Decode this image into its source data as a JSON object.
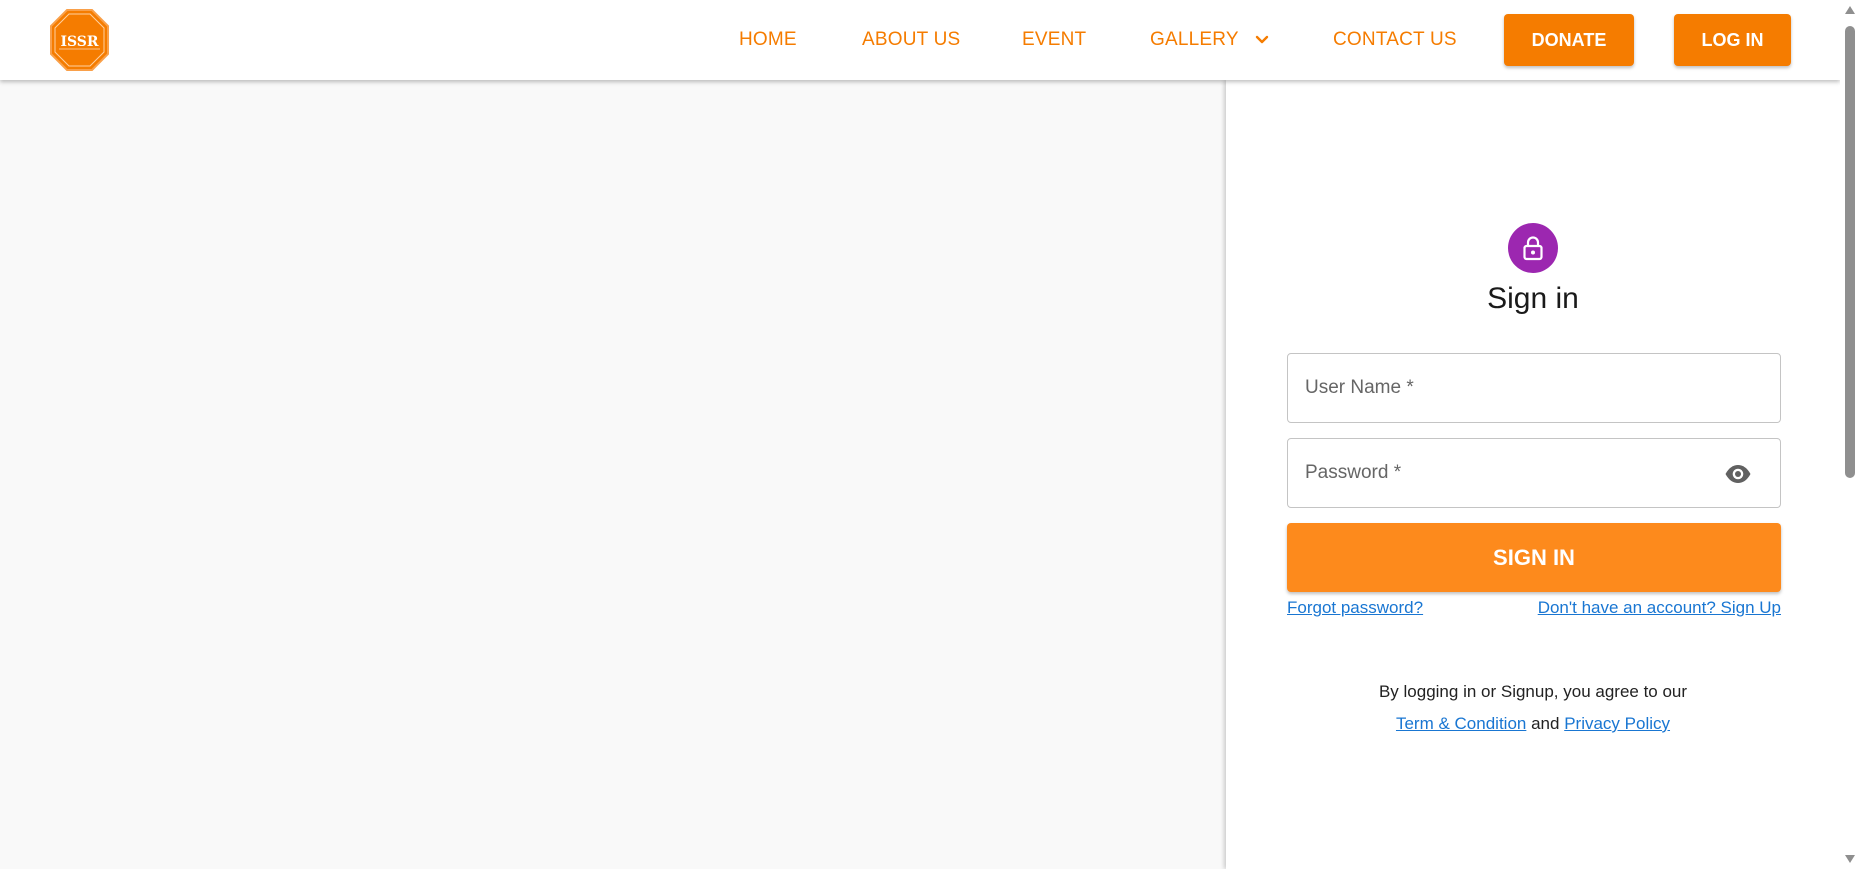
{
  "header": {
    "logo_text": "ISSR",
    "nav": {
      "home": "HOME",
      "about": "ABOUT US",
      "event": "EVENT",
      "gallery": "GALLERY",
      "contact": "CONTACT US"
    },
    "donate_label": "DONATE",
    "login_label": "LOG IN"
  },
  "signin": {
    "title": "Sign in",
    "username_placeholder": "User Name *",
    "password_placeholder": "Password *",
    "submit_label": "SIGN IN",
    "forgot_label": "Forgot password?",
    "signup_label": "Don't have an account? Sign Up",
    "agree_text": "By logging in or Signup, you agree to our",
    "terms_label": "Term & Condition",
    "and_text": "and",
    "privacy_label": "Privacy Policy"
  },
  "icons": {
    "lock": "lock-icon",
    "eye": "eye-icon",
    "chevron": "chevron-down-icon"
  },
  "colors": {
    "accent": "#f57c00",
    "signin_button": "#fd8a1c",
    "avatar": "#9c27b0",
    "link": "#1976d2"
  }
}
